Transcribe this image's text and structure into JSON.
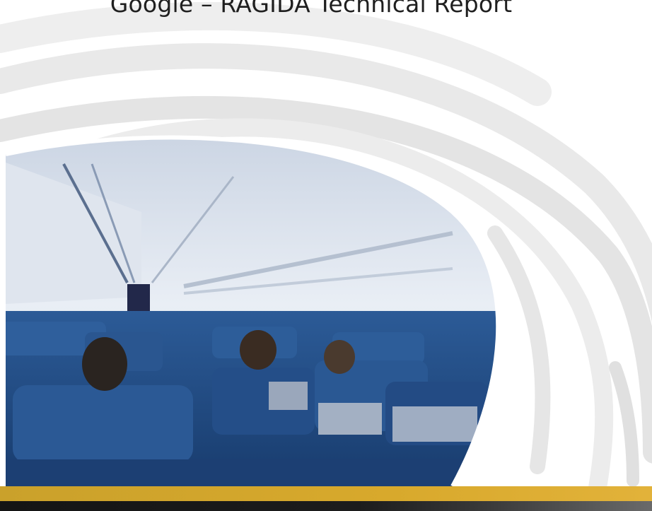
{
  "report": {
    "title": "Google – RAGIDA Technical Report"
  },
  "cover_image": {
    "subject": "aircraft-cabin-photo"
  },
  "colors": {
    "arc_light": "#ececec",
    "arc_mid": "#e3e3e3",
    "gold_band": "#d6a52b",
    "dark_band": "#1a1a1a"
  }
}
